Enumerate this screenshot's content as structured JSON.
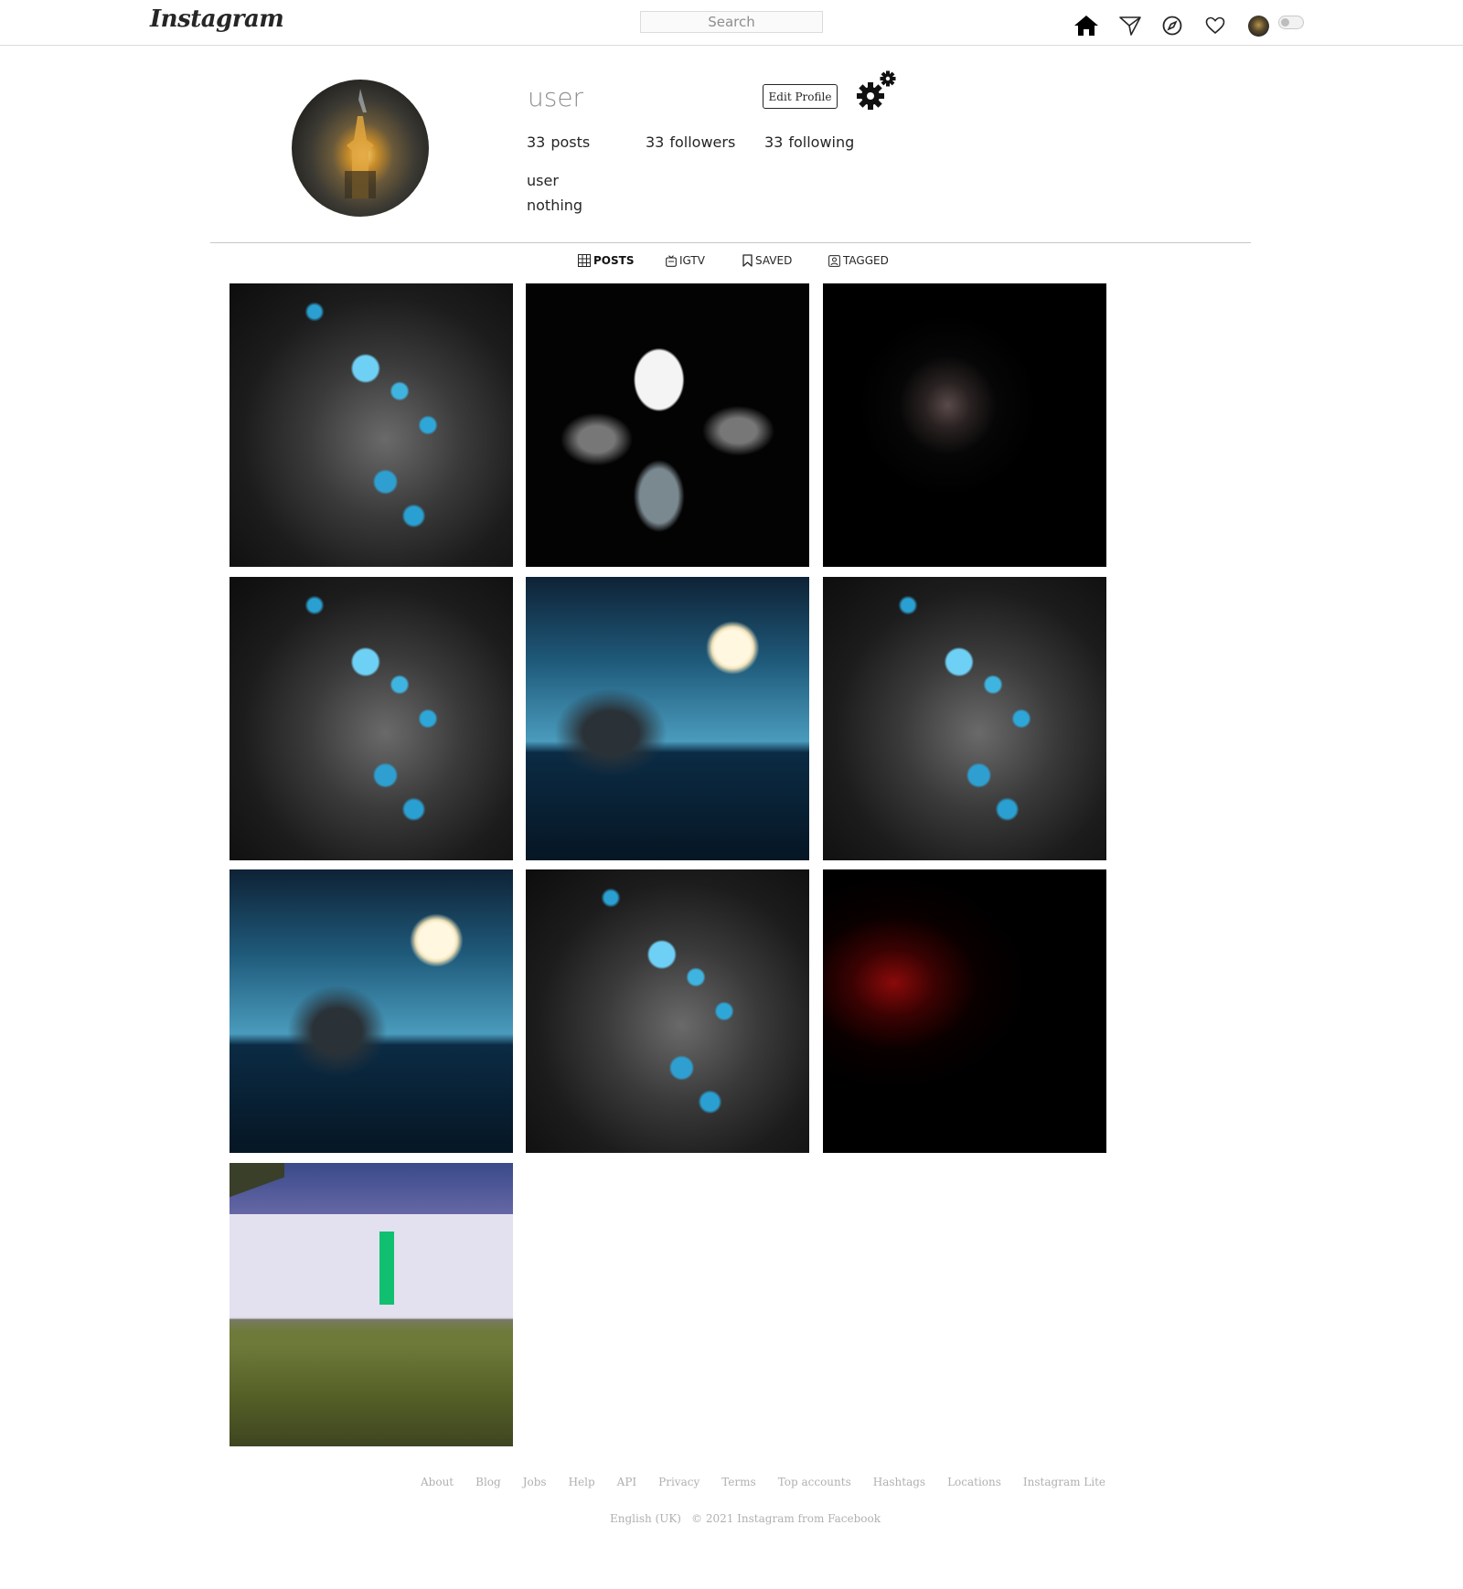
{
  "topbar": {
    "logo": "Instagram",
    "search_placeholder": "Search",
    "icons": [
      "home-icon",
      "send-icon",
      "explore-icon",
      "heart-icon"
    ]
  },
  "profile": {
    "username": "user",
    "edit_label": "Edit Profile",
    "posts_count": "33",
    "posts_label": "posts",
    "followers_count": "33",
    "followers_label": "followers",
    "following_count": "33",
    "following_label": "following",
    "full_name": "user",
    "bio": "nothing"
  },
  "tabs": [
    {
      "label": "POSTS",
      "icon": "grid-icon",
      "active": true
    },
    {
      "label": "IGTV",
      "icon": "tv-icon",
      "active": false
    },
    {
      "label": "SAVED",
      "icon": "bookmark-icon",
      "active": false
    },
    {
      "label": "TAGGED",
      "icon": "tag-icon",
      "active": false
    }
  ],
  "posts": [
    {
      "subject": "leaf-drops"
    },
    {
      "subject": "dice"
    },
    {
      "subject": "dark-emblem"
    },
    {
      "subject": "leaf-drops"
    },
    {
      "subject": "ship-moon"
    },
    {
      "subject": "leaf-drops"
    },
    {
      "subject": "ship-moon"
    },
    {
      "subject": "leaf-drops"
    },
    {
      "subject": "red-figure"
    },
    {
      "subject": "campus-people"
    }
  ],
  "footer": {
    "links": [
      "About",
      "Blog",
      "Jobs",
      "Help",
      "API",
      "Privacy",
      "Terms",
      "Top accounts",
      "Hashtags",
      "Locations",
      "Instagram Lite"
    ],
    "language": "English (UK)",
    "copyright": "© 2021 Instagram from Facebook"
  }
}
